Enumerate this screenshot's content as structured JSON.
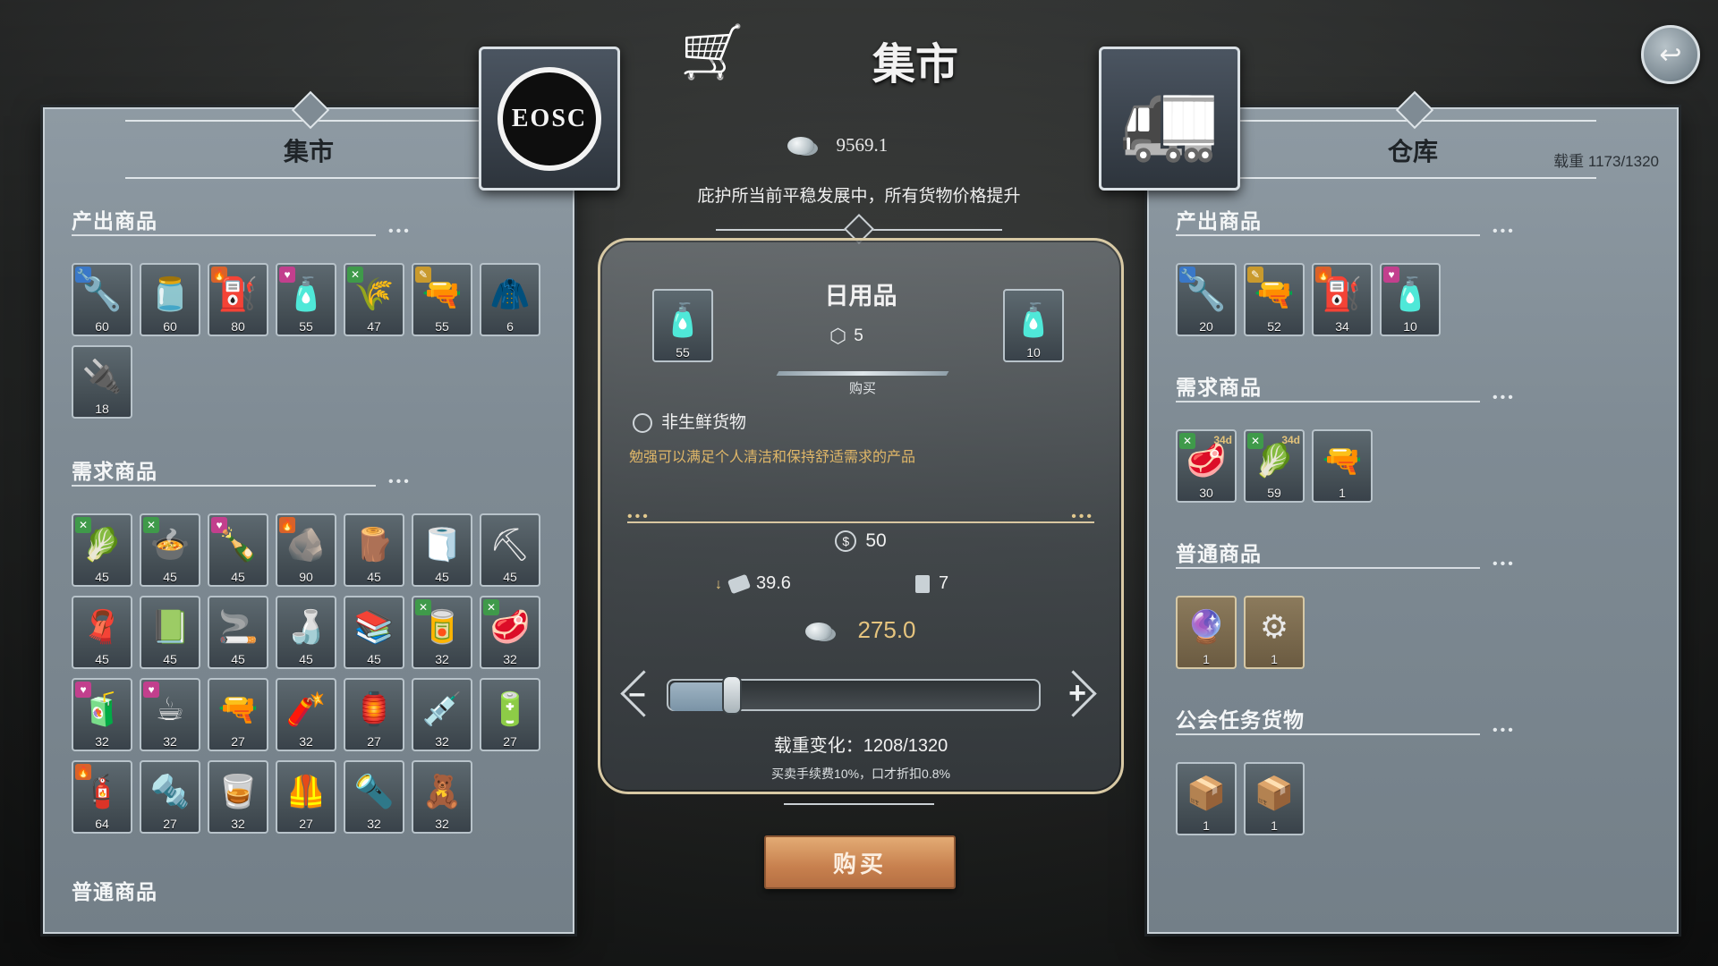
{
  "header": {
    "title": "集市",
    "money": "9569.1",
    "notice": "庇护所当前平稳发展中，所有货物价格提升",
    "left_portrait_text": "EOSC"
  },
  "left_panel": {
    "title": "集市",
    "sections": [
      {
        "title": "产出商品",
        "items": [
          {
            "icon": "hammer-wrench-icon",
            "glyph": "🔧",
            "badge": "blue",
            "qty": "60"
          },
          {
            "icon": "jar-icon",
            "glyph": "🫙",
            "qty": "60"
          },
          {
            "icon": "fuel-can-icon",
            "glyph": "⛽",
            "badge": "orange",
            "qty": "80"
          },
          {
            "icon": "daily-goods-icon",
            "glyph": "🧴",
            "badge": "pink",
            "qty": "55"
          },
          {
            "icon": "wheat-icon",
            "glyph": "🌾",
            "badge": "green",
            "qty": "47"
          },
          {
            "icon": "ammo-icon",
            "glyph": "🔫",
            "badge": "yellow",
            "qty": "55"
          },
          {
            "icon": "jacket-icon",
            "glyph": "🧥",
            "qty": "6"
          },
          {
            "icon": "circuit-board-icon",
            "glyph": "🔌",
            "qty": "18"
          }
        ]
      },
      {
        "title": "需求商品",
        "items": [
          {
            "icon": "dried-food-icon",
            "glyph": "🥬",
            "badge": "green",
            "qty": "45"
          },
          {
            "icon": "pot-icon",
            "glyph": "🍲",
            "badge": "green",
            "qty": "45"
          },
          {
            "icon": "liquor-icon",
            "glyph": "🍾",
            "badge": "pink",
            "qty": "45"
          },
          {
            "icon": "coal-icon",
            "glyph": "🪨",
            "badge": "orange",
            "qty": "90"
          },
          {
            "icon": "logs-icon",
            "glyph": "🪵",
            "qty": "45"
          },
          {
            "icon": "cloth-icon",
            "glyph": "🧻",
            "qty": "45"
          },
          {
            "icon": "ore-icon",
            "glyph": "⛏",
            "qty": "45"
          },
          {
            "icon": "fabric-icon",
            "glyph": "🧣",
            "qty": "45"
          },
          {
            "icon": "textile-icon",
            "glyph": "📗",
            "qty": "45"
          },
          {
            "icon": "cigarette-pack-icon",
            "glyph": "🚬",
            "qty": "45"
          },
          {
            "icon": "bottle-icon",
            "glyph": "🍶",
            "qty": "45"
          },
          {
            "icon": "books-icon",
            "glyph": "📚",
            "qty": "45"
          },
          {
            "icon": "canned-food-icon",
            "glyph": "🥫",
            "badge": "green",
            "qty": "32"
          },
          {
            "icon": "meat-icon",
            "glyph": "🥩",
            "badge": "green",
            "qty": "32"
          },
          {
            "icon": "tea-can-icon",
            "glyph": "🧃",
            "badge": "pink",
            "qty": "32"
          },
          {
            "icon": "coffee-beans-icon",
            "glyph": "☕",
            "badge": "pink",
            "qty": "32"
          },
          {
            "icon": "rifle-icon",
            "glyph": "🔫",
            "qty": "27"
          },
          {
            "icon": "dynamite-icon",
            "glyph": "🧨",
            "qty": "32"
          },
          {
            "icon": "lantern-icon",
            "glyph": "🏮",
            "qty": "27"
          },
          {
            "icon": "syringe-icon",
            "glyph": "💉",
            "qty": "32"
          },
          {
            "icon": "battery-icon",
            "glyph": "🔋",
            "qty": "27"
          },
          {
            "icon": "gas-tank-icon",
            "glyph": "🧯",
            "badge": "orange",
            "qty": "64"
          },
          {
            "icon": "steel-plate-icon",
            "glyph": "🔩",
            "qty": "27"
          },
          {
            "icon": "whiskey-icon",
            "glyph": "🥃",
            "qty": "32"
          },
          {
            "icon": "armor-icon",
            "glyph": "🦺",
            "qty": "27"
          },
          {
            "icon": "bullet-icon",
            "glyph": "🔦",
            "qty": "32"
          },
          {
            "icon": "doll-icon",
            "glyph": "🧸",
            "qty": "32"
          }
        ]
      },
      {
        "title": "普通商品",
        "items": []
      }
    ]
  },
  "right_panel": {
    "title": "仓库",
    "weight": "载重 1173/1320",
    "sections": [
      {
        "title": "产出商品",
        "items": [
          {
            "icon": "hammer-wrench-icon",
            "glyph": "🔧",
            "badge": "blue",
            "qty": "20"
          },
          {
            "icon": "ammo-icon",
            "glyph": "🔫",
            "badge": "yellow",
            "qty": "52"
          },
          {
            "icon": "fuel-can-icon",
            "glyph": "⛽",
            "badge": "orange",
            "qty": "34"
          },
          {
            "icon": "daily-goods-icon",
            "glyph": "🧴",
            "badge": "pink",
            "qty": "10"
          }
        ]
      },
      {
        "title": "需求商品",
        "items": [
          {
            "icon": "meat-icon",
            "glyph": "🥩",
            "badge": "green",
            "days": "34d",
            "qty": "30"
          },
          {
            "icon": "dried-food-icon",
            "glyph": "🥬",
            "badge": "green",
            "days": "34d",
            "qty": "59"
          },
          {
            "icon": "rifle-icon",
            "glyph": "🔫",
            "qty": "1"
          }
        ]
      },
      {
        "title": "普通商品",
        "items": [
          {
            "icon": "lamp-device-icon",
            "glyph": "🔮",
            "gold": true,
            "qty": "1"
          },
          {
            "icon": "mechanical-part-icon",
            "glyph": "⚙",
            "gold": true,
            "qty": "1"
          }
        ]
      },
      {
        "title": "公会任务货物",
        "items": [
          {
            "icon": "cardboard-box-icon",
            "glyph": "📦",
            "qty": "1"
          },
          {
            "icon": "cardboard-box-icon",
            "glyph": "📦",
            "qty": "1"
          }
        ]
      }
    ]
  },
  "trade": {
    "title": "日用品",
    "market_qty": "55",
    "warehouse_qty": "10",
    "stack": "5",
    "mode_label": "购买",
    "category": "非生鲜货物",
    "description": "勉强可以满足个人清洁和保持舒适需求的产品",
    "unit_price": "50",
    "base_price": "39.6",
    "supply": "7",
    "total": "275.0",
    "slider_fraction": 0.15,
    "weight_change": "载重变化：1208/1320",
    "fee": "买卖手续费10%，口才折扣0.8%",
    "buy_button": "购买"
  },
  "colors": {
    "accent_gold": "#e6c47e",
    "buy_button": "#c7804e",
    "panel": "#7f8b94"
  }
}
